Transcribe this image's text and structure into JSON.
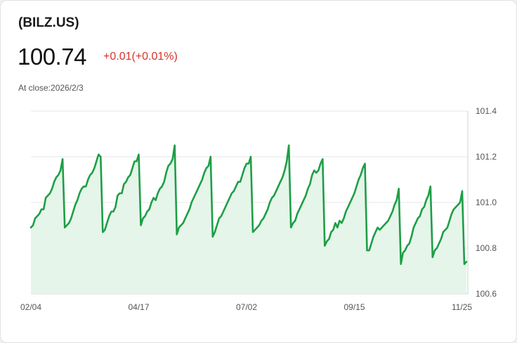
{
  "header": {
    "ticker": "(BILZ.US)",
    "price": "100.74",
    "change": "+0.01(+0.01%)",
    "close_label": "At close:2026/2/3"
  },
  "colors": {
    "line": "#1e9e46",
    "fill": "#e5f5ea",
    "change": "#d6332a",
    "grid": "#e4e4e4"
  },
  "chart_data": {
    "type": "area",
    "ylim": [
      100.6,
      101.4
    ],
    "ytick_labels": [
      "101.4",
      "101.2",
      "101.0",
      "100.8",
      "100.6"
    ],
    "ytick_values": [
      101.4,
      101.2,
      101.0,
      100.8,
      100.6
    ],
    "xtick_labels": [
      "02/04",
      "04/17",
      "07/02",
      "09/15",
      "11/25"
    ],
    "xtick_index": [
      0,
      51,
      102,
      153,
      204
    ],
    "grid": true,
    "series": [
      {
        "values": [
          100.89,
          100.9,
          100.93,
          100.94,
          100.95,
          100.97,
          100.97,
          101.02,
          101.03,
          101.04,
          101.06,
          101.09,
          101.11,
          101.12,
          101.14,
          101.19,
          100.89,
          100.9,
          100.91,
          100.93,
          100.96,
          100.99,
          101.01,
          101.04,
          101.06,
          101.07,
          101.07,
          101.1,
          101.12,
          101.13,
          101.15,
          101.18,
          101.21,
          101.2,
          100.87,
          100.88,
          100.91,
          100.94,
          100.96,
          100.96,
          100.98,
          101.03,
          101.04,
          101.04,
          101.08,
          101.09,
          101.11,
          101.12,
          101.15,
          101.18,
          101.18,
          101.21,
          100.9,
          100.93,
          100.94,
          100.96,
          100.97,
          101.0,
          101.02,
          101.01,
          101.04,
          101.06,
          101.07,
          101.09,
          101.13,
          101.16,
          101.17,
          101.19,
          101.25,
          100.86,
          100.89,
          100.9,
          100.91,
          100.93,
          100.95,
          100.97,
          101.0,
          101.02,
          101.04,
          101.06,
          101.08,
          101.1,
          101.13,
          101.15,
          101.16,
          101.2,
          100.85,
          100.87,
          100.9,
          100.93,
          100.94,
          100.96,
          100.98,
          101.0,
          101.02,
          101.04,
          101.05,
          101.07,
          101.09,
          101.09,
          101.12,
          101.15,
          101.17,
          101.17,
          101.2,
          100.87,
          100.88,
          100.89,
          100.9,
          100.92,
          100.93,
          100.95,
          100.97,
          101.0,
          101.02,
          101.03,
          101.05,
          101.07,
          101.09,
          101.11,
          101.14,
          101.18,
          101.25,
          100.89,
          100.91,
          100.92,
          100.95,
          100.97,
          100.99,
          101.01,
          101.03,
          101.06,
          101.08,
          101.12,
          101.14,
          101.13,
          101.14,
          101.17,
          101.19,
          100.81,
          100.83,
          100.84,
          100.87,
          100.88,
          100.91,
          100.89,
          100.92,
          100.91,
          100.93,
          100.96,
          100.98,
          101.0,
          101.02,
          101.04,
          101.07,
          101.1,
          101.12,
          101.15,
          101.17,
          100.79,
          100.79,
          100.82,
          100.85,
          100.87,
          100.89,
          100.88,
          100.89,
          100.9,
          100.91,
          100.92,
          100.94,
          100.96,
          100.99,
          101.01,
          101.06,
          100.73,
          100.78,
          100.79,
          100.81,
          100.82,
          100.85,
          100.89,
          100.91,
          100.93,
          100.94,
          100.97,
          100.98,
          101.01,
          101.03,
          101.07,
          100.76,
          100.79,
          100.8,
          100.82,
          100.84,
          100.87,
          100.88,
          100.89,
          100.92,
          100.95,
          100.97,
          100.98,
          100.99,
          101.0,
          101.05,
          100.73,
          100.74
        ]
      }
    ]
  }
}
